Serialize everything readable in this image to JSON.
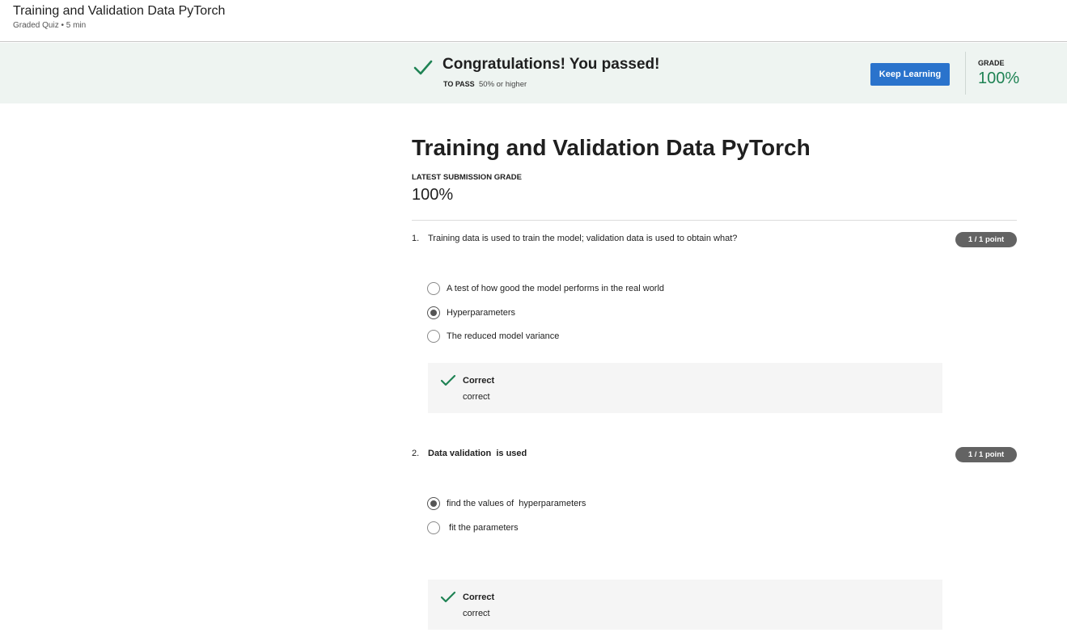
{
  "header": {
    "title": "Training and Validation Data PyTorch",
    "subtitle": "Graded Quiz • 5 min"
  },
  "banner": {
    "message": "Congratulations! You passed!",
    "to_pass_label": "TO PASS",
    "to_pass_value": "50% or higher",
    "keep_learning_label": "Keep Learning",
    "grade_label": "GRADE",
    "grade_value": "100%"
  },
  "quiz": {
    "title": "Training and Validation Data PyTorch",
    "latest_label": "LATEST SUBMISSION GRADE",
    "latest_value": "100%",
    "questions": [
      {
        "number": "1.",
        "text": "Training data is used to train the model; validation data is used to obtain what?",
        "points": "1 / 1 point",
        "options": [
          "A test of how good the model performs in the real world",
          "Hyperparameters",
          "The reduced model variance"
        ],
        "selected": "Hyperparameters",
        "feedback_title": "Correct",
        "feedback_text": "correct"
      },
      {
        "number": "2.",
        "text": "Data validation  is used",
        "points": "1 / 1 point",
        "options": [
          "find the values of  hyperparameters",
          " fit the parameters"
        ],
        "selected": "find the values of  hyperparameters",
        "feedback_title": "Correct",
        "feedback_text": "correct"
      }
    ]
  },
  "colors": {
    "banner_bg": "#eef4f1",
    "success_green": "#1f8354",
    "button_blue": "#2a73cc",
    "points_badge": "#636363"
  },
  "icons": {
    "pass_check": "check-icon",
    "feedback_check": "check-icon"
  }
}
